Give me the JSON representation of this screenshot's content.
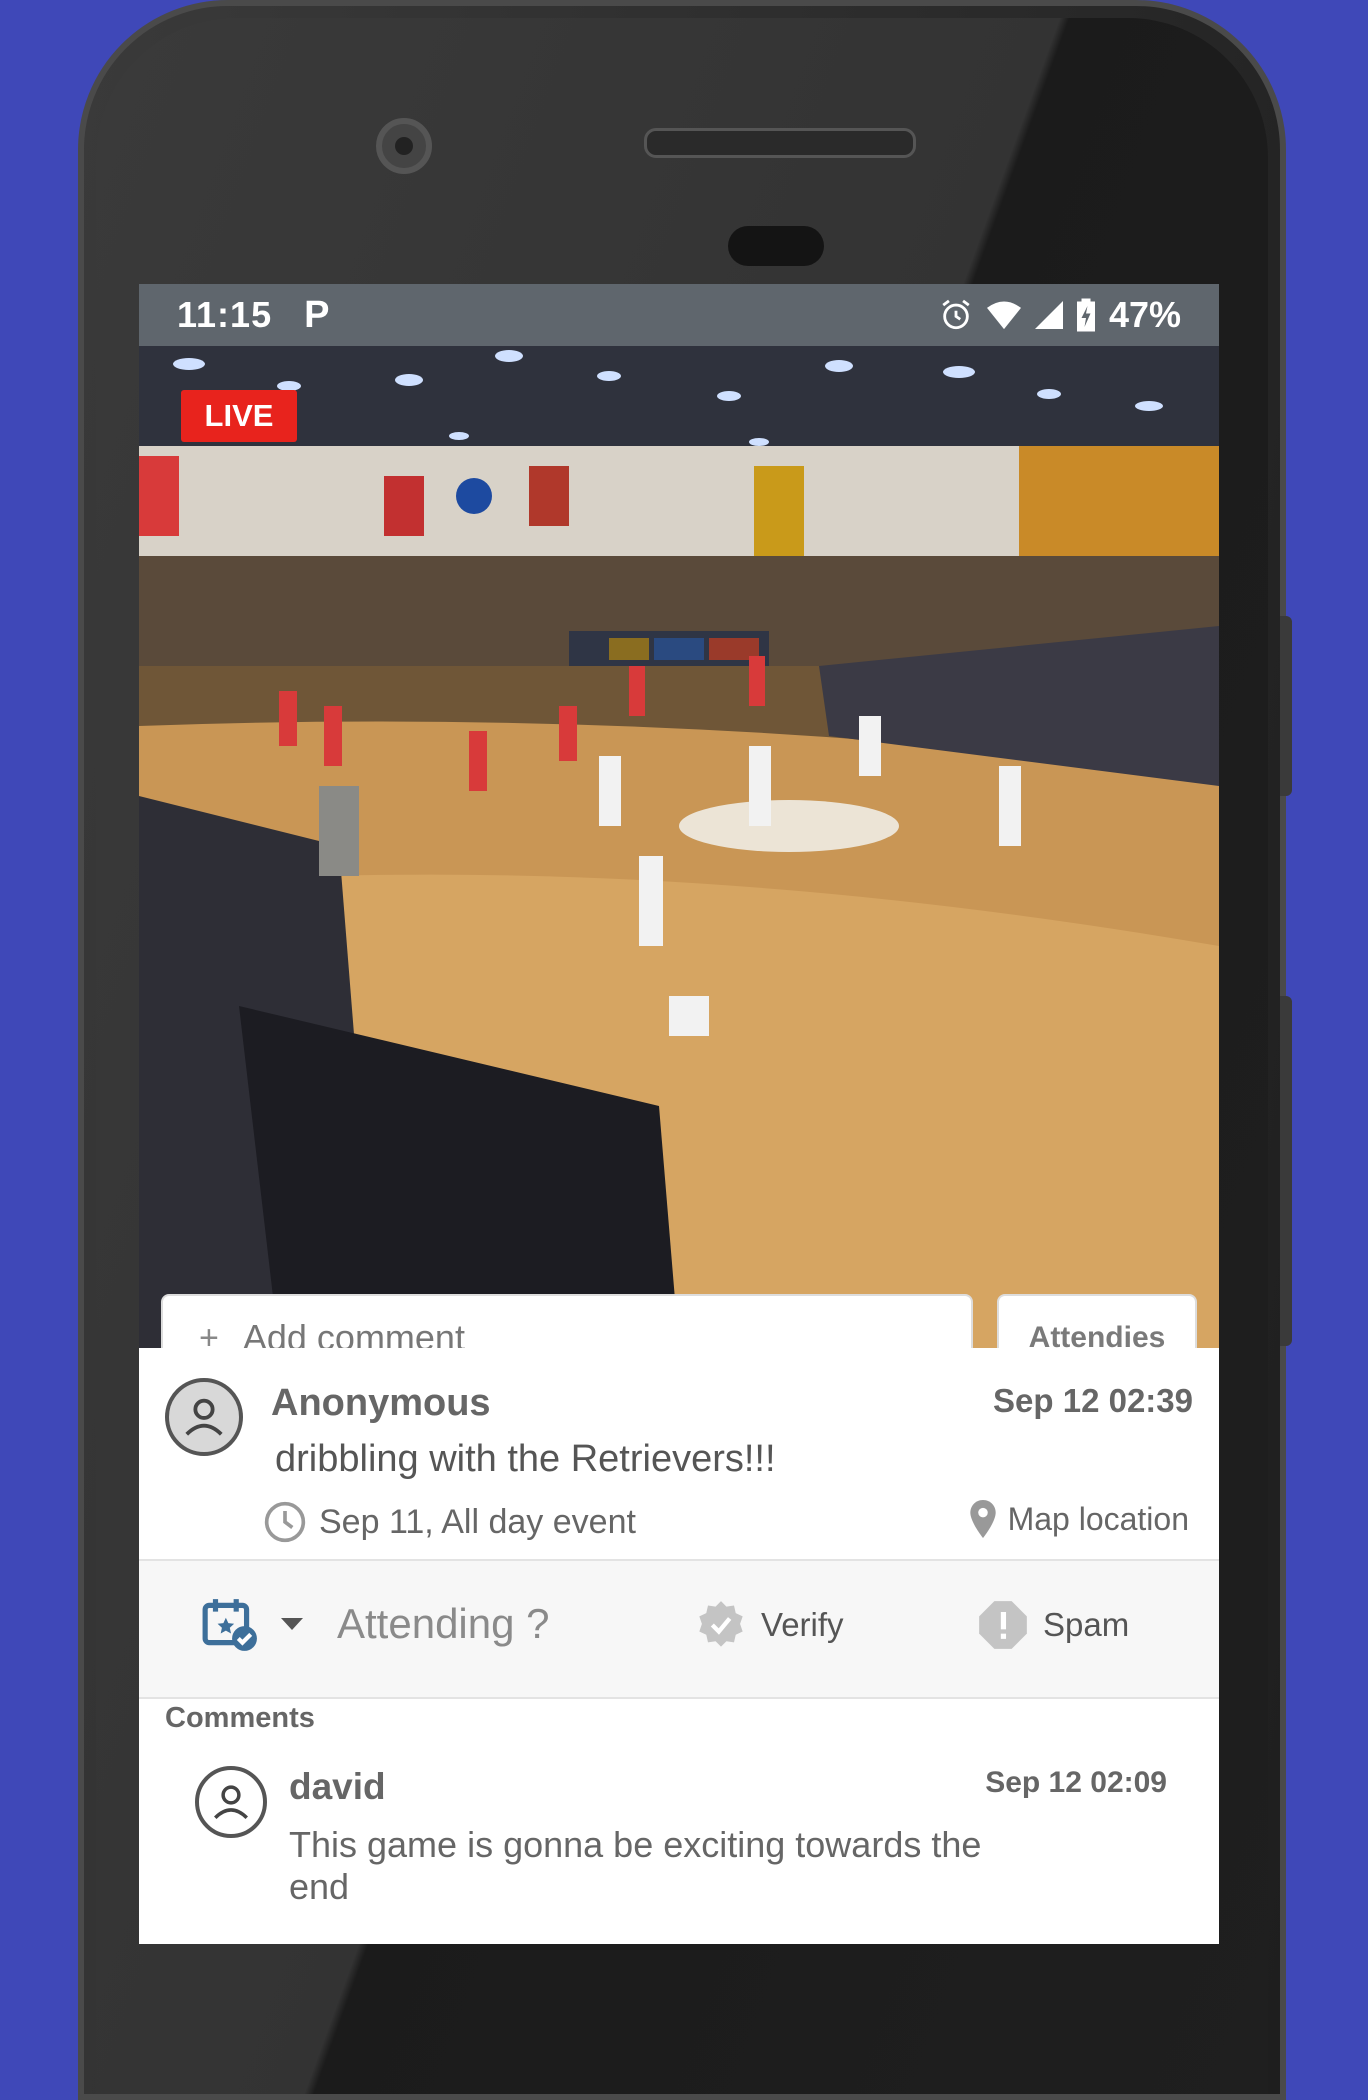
{
  "statusbar": {
    "time": "11:15",
    "app_badge": "P",
    "battery_percent": "47%",
    "icons": [
      "alarm-icon",
      "wifi-icon",
      "signal-icon",
      "battery-icon"
    ]
  },
  "video": {
    "live_label": "LIVE"
  },
  "composer": {
    "placeholder": "Add comment",
    "attendies_label": "Attendies"
  },
  "post": {
    "author": "Anonymous",
    "timestamp": "Sep 12 02:39",
    "text": "dribbling with the Retrievers!!!",
    "event_time": "Sep 11, All day event",
    "map_label": "Map location"
  },
  "actions": {
    "attending_label": "Attending ?",
    "verify_label": "Verify",
    "spam_label": "Spam"
  },
  "comments": {
    "heading": "Comments",
    "items": [
      {
        "author": "david",
        "timestamp": "Sep 12 02:09",
        "text": "This game is gonna be exciting towards the end"
      }
    ]
  },
  "colors": {
    "background": "#3f48b8",
    "live_red": "#e8231d",
    "statusbar": "#5f666d",
    "calendar_accent": "#3d6f9a"
  }
}
